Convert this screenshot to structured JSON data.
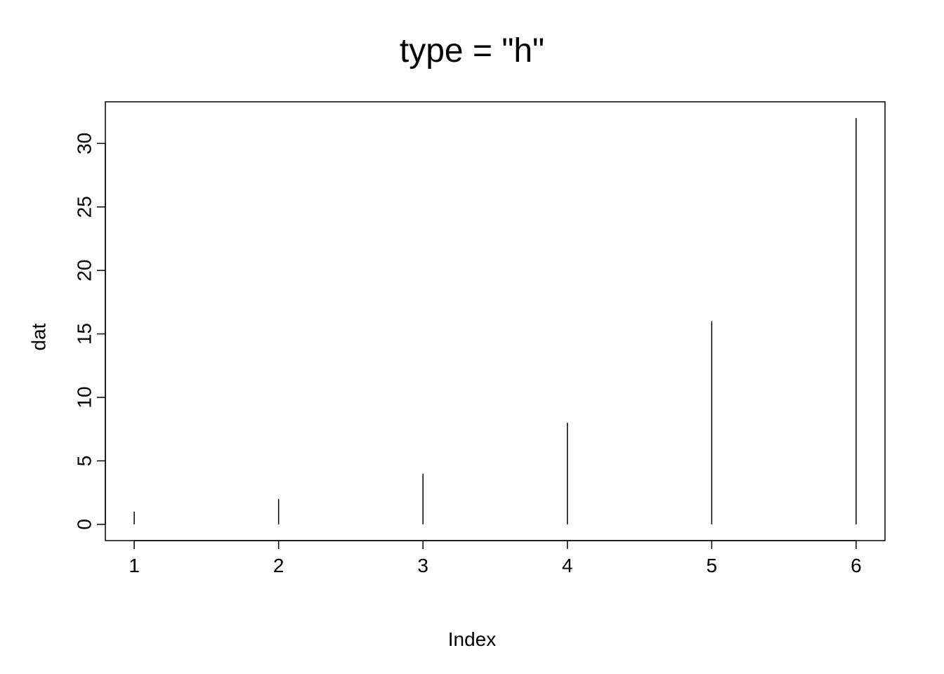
{
  "chart_data": {
    "type": "bar",
    "title": "type = \"h\"",
    "xlabel": "Index",
    "ylabel": "dat",
    "categories": [
      1,
      2,
      3,
      4,
      5,
      6
    ],
    "values": [
      1,
      2,
      4,
      8,
      16,
      32
    ],
    "xlim": [
      1,
      6
    ],
    "ylim": [
      0,
      32
    ],
    "x_ticks": [
      1,
      2,
      3,
      4,
      5,
      6
    ],
    "y_ticks": [
      0,
      5,
      10,
      15,
      20,
      25,
      30
    ]
  }
}
